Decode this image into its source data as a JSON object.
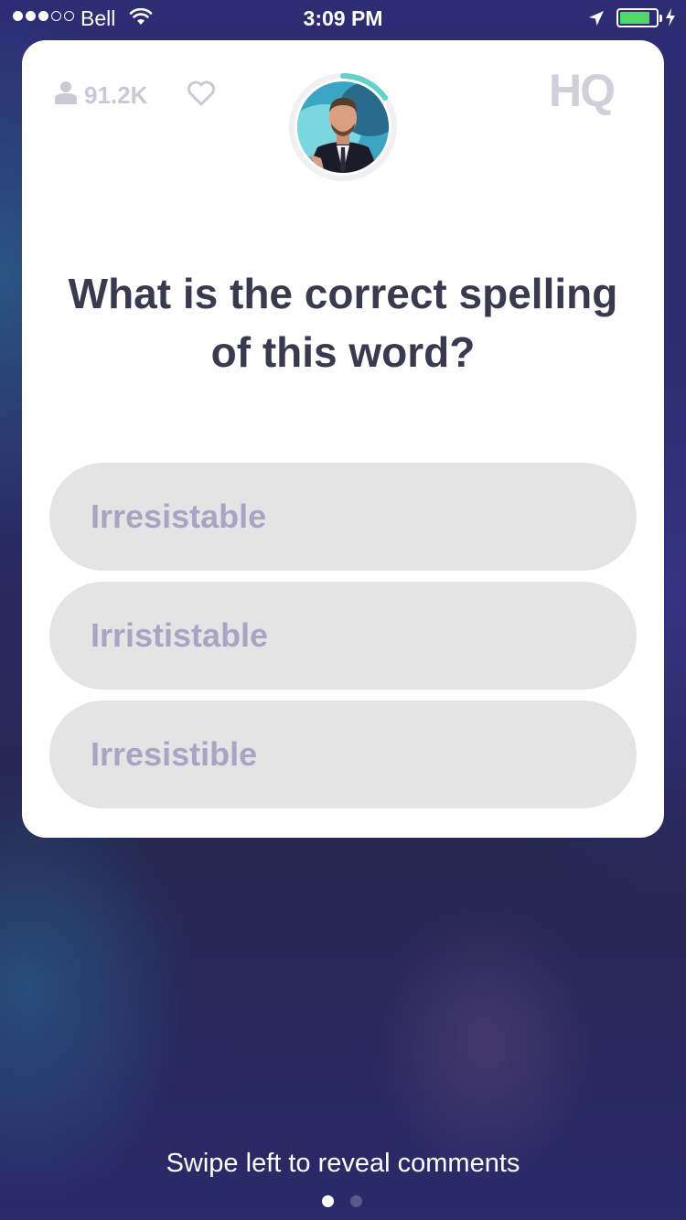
{
  "status_bar": {
    "carrier": "Bell",
    "time": "3:09 PM",
    "signal_bars_filled": 3,
    "signal_bars_total": 5,
    "battery_level": 0.85,
    "battery_color": "#4cd964"
  },
  "card": {
    "viewer_count": "91.2K",
    "logo": "HQ",
    "question": "What is the correct spelling of this word?",
    "answers": [
      {
        "label": "Irresistable"
      },
      {
        "label": "Irrististable"
      },
      {
        "label": "Irresistible"
      }
    ],
    "timer_ring_color": "#5fd3c8",
    "answer_bg": "#e4e4e4",
    "answer_text_color": "#a7a5c2"
  },
  "footer": {
    "hint": "Swipe left to reveal comments",
    "page_count": 2,
    "active_page": 1
  }
}
